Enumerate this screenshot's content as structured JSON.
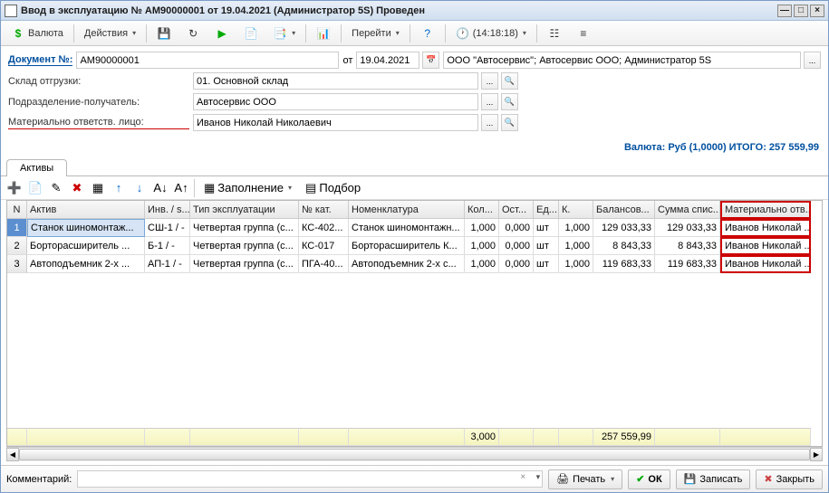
{
  "title": "Ввод в эксплуатацию № АМ90000001 от 19.04.2021 (Администратор 5S) Проведен",
  "toolbar": {
    "currency": "Валюта",
    "actions": "Действия",
    "goto": "Перейти",
    "time": "(14:18:18)"
  },
  "form": {
    "docnum_label": "Документ №:",
    "docnum": "АМ90000001",
    "from_label": "от",
    "date": "19.04.2021",
    "org": "ООО \"Автосервис\"; Автосервис ООО; Администратор 5S",
    "warehouse_label": "Склад отгрузки:",
    "warehouse": "01.  Основной склад",
    "dept_label": "Подразделение-получатель:",
    "dept": "Автосервис ООО",
    "resp_label": "Материально ответств. лицо:",
    "resp": "Иванов Николай Николаевич"
  },
  "summary": "Валюта: Руб (1,0000) ИТОГО: 257 559,99",
  "tab_assets": "Активы",
  "gridtb": {
    "fill": "Заполнение",
    "pick": "Подбор"
  },
  "cols": {
    "n": "N",
    "asset": "Актив",
    "inv": "Инв. / s...",
    "type": "Тип эксплуатации",
    "kat": "№ кат.",
    "nom": "Номенклатура",
    "qty": "Кол...",
    "ost": "Ост...",
    "ed": "Ед...",
    "k": "К.",
    "bal": "Балансов...",
    "sum": "Сумма спис...",
    "mat": "Материально отв..."
  },
  "rows": [
    {
      "n": "1",
      "asset": "Станок шиномонтаж...",
      "inv": "СШ-1 / -",
      "type": "Четвертая группа (с...",
      "kat": "КС-402...",
      "nom": "Станок шиномонтажн...",
      "qty": "1,000",
      "ost": "0,000",
      "ed": "шт",
      "k": "1,000",
      "bal": "129 033,33",
      "sum": "129 033,33",
      "mat": "Иванов Николай ..."
    },
    {
      "n": "2",
      "asset": "Борторасширитель ...",
      "inv": "Б-1 / -",
      "type": "Четвертая группа (с...",
      "kat": "КС-017",
      "nom": "Борторасширитель К...",
      "qty": "1,000",
      "ost": "0,000",
      "ed": "шт",
      "k": "1,000",
      "bal": "8 843,33",
      "sum": "8 843,33",
      "mat": "Иванов Николай ..."
    },
    {
      "n": "3",
      "asset": "Автоподъемник 2-х ...",
      "inv": "АП-1 / -",
      "type": "Четвертая группа (с...",
      "kat": "ПГА-40...",
      "nom": "Автоподъемник 2-х с...",
      "qty": "1,000",
      "ost": "0,000",
      "ed": "шт",
      "k": "1,000",
      "bal": "119 683,33",
      "sum": "119 683,33",
      "mat": "Иванов Николай ..."
    }
  ],
  "totals": {
    "qty": "3,000",
    "bal": "257 559,99"
  },
  "footer": {
    "comment_label": "Комментарий:",
    "print": "Печать",
    "ok": "ОК",
    "save": "Записать",
    "close": "Закрыть"
  }
}
